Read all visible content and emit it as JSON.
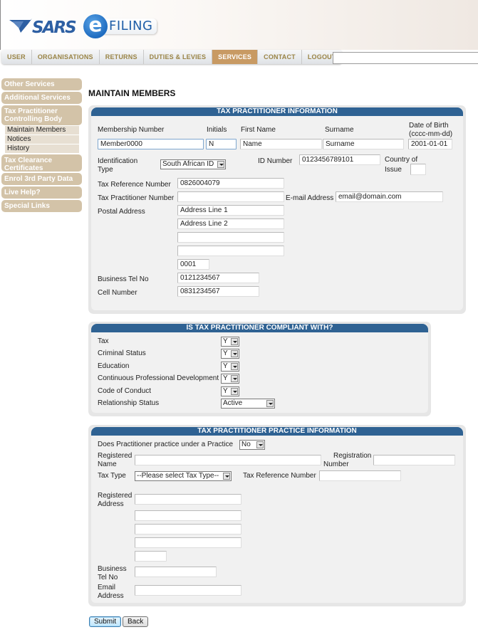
{
  "header": {
    "logo_text": "SARS",
    "logo_e": "e",
    "logo_filing": "FILING"
  },
  "nav": {
    "items": [
      {
        "label": "USER",
        "active": false
      },
      {
        "label": "ORGANISATIONS",
        "active": false
      },
      {
        "label": "RETURNS",
        "active": false
      },
      {
        "label": "DUTIES & LEVIES",
        "active": false
      },
      {
        "label": "SERVICES",
        "active": true
      },
      {
        "label": "CONTACT",
        "active": false
      },
      {
        "label": "LOGOUT",
        "active": false
      }
    ],
    "search_value": ""
  },
  "sidebar": {
    "items": [
      {
        "label": "Other Services"
      },
      {
        "label": "Additional Services"
      },
      {
        "label": "Tax Practitioner Controlling Body",
        "sub": [
          "Maintain Members",
          "Notices",
          "History"
        ]
      },
      {
        "label": "Tax Clearance Certificates"
      },
      {
        "label": "Enrol 3rd Party Data"
      },
      {
        "label": "Live Help?"
      },
      {
        "label": "Special Links"
      }
    ]
  },
  "page_title": "MAINTAIN MEMBERS",
  "practitioner_info": {
    "heading": "TAX PRACTITIONER INFORMATION",
    "labels": {
      "membership_number": "Membership Number",
      "initials": "Initials",
      "first_name": "First Name",
      "surname": "Surname",
      "dob_1": "Date of Birth",
      "dob_2": "(cccc-mm-dd)",
      "id_type_1": "Identification",
      "id_type_2": "Type",
      "id_number": "ID Number",
      "country_1": "Country of",
      "country_2": "Issue",
      "tax_ref": "Tax Reference Number",
      "tp_number": "Tax Practitioner Number",
      "email": "E-mail Address",
      "postal": "Postal Address",
      "business_tel": "Business Tel No",
      "cell": "Cell Number"
    },
    "values": {
      "membership_number": "Member0000",
      "initials": "N",
      "first_name": "Name",
      "surname": "Surname",
      "dob": "2001-01-01",
      "id_type": "South African ID",
      "id_number": "0123456789101",
      "country": "",
      "tax_ref": "0826004079",
      "tp_number": "",
      "email": "email@domain.com",
      "postal_1": "Address Line 1",
      "postal_2": "Address Line 2",
      "postal_3": "",
      "postal_4": "",
      "postal_code": "0001",
      "business_tel": "0121234567",
      "cell": "0831234567"
    }
  },
  "compliance": {
    "heading": "IS TAX PRACTITIONER COMPLIANT WITH?",
    "rows": [
      {
        "label": "Tax",
        "value": "Y"
      },
      {
        "label": "Criminal Status",
        "value": "Y"
      },
      {
        "label": "Education",
        "value": "Y"
      },
      {
        "label": "Continuous Professional Development",
        "value": "Y"
      },
      {
        "label": "Code of Conduct",
        "value": "Y"
      },
      {
        "label": "Relationship Status",
        "value": "Active"
      }
    ]
  },
  "practice": {
    "heading": "TAX PRACTITIONER PRACTICE INFORMATION",
    "labels": {
      "under_practice": "Does Practitioner practice under a Practice",
      "reg_name_1": "Registered",
      "reg_name_2": "Name",
      "reg_no_1": "Registration",
      "reg_no_2": "Number",
      "tax_type": "Tax Type",
      "tax_ref": "Tax Reference Number",
      "reg_addr_1": "Registered",
      "reg_addr_2": "Address",
      "bus_tel_1": "Business",
      "bus_tel_2": "Tel No",
      "email_1": "Email",
      "email_2": "Address"
    },
    "values": {
      "under_practice": "No",
      "reg_name": "",
      "reg_no": "",
      "tax_type": "--Please select Tax Type--",
      "tax_ref": "",
      "addr_1": "",
      "addr_2": "",
      "addr_3": "",
      "addr_4": "",
      "addr_code": "",
      "bus_tel": "",
      "email": ""
    }
  },
  "buttons": {
    "submit": "Submit",
    "back": "Back"
  }
}
